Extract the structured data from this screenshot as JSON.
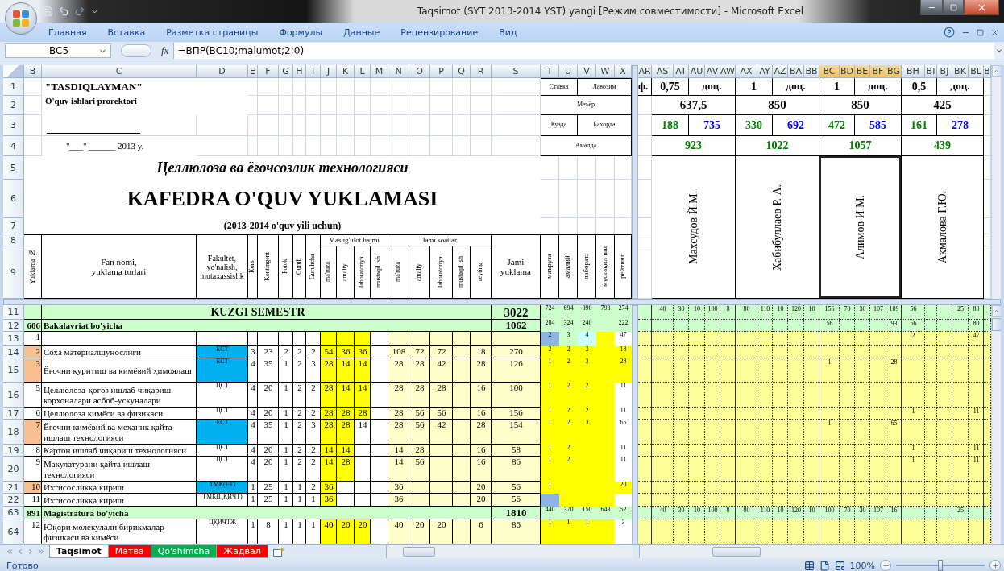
{
  "window": {
    "title": "Taqsimot (SYT 2013-2014 YST)  yangi  [Режим совместимости] - Microsoft Excel"
  },
  "ribbon_tabs": [
    "Главная",
    "Вставка",
    "Разметка страницы",
    "Формулы",
    "Данные",
    "Рецензирование",
    "Вид"
  ],
  "formula_bar": {
    "name_box": "BC5",
    "insert_function": "fx",
    "formula": "=ВПР(BC10;malumot;2;0)"
  },
  "left_columns": [
    {
      "label": "B",
      "selected": false
    },
    {
      "label": "C",
      "selected": false
    },
    {
      "label": "D",
      "selected": false
    },
    {
      "label": "E",
      "selected": false
    },
    {
      "label": "F",
      "selected": false
    },
    {
      "label": "G",
      "selected": false
    },
    {
      "label": "H",
      "selected": false
    },
    {
      "label": "I",
      "selected": false
    },
    {
      "label": "J",
      "selected": false
    },
    {
      "label": "K",
      "selected": false
    },
    {
      "label": "L",
      "selected": false
    },
    {
      "label": "M",
      "selected": false
    },
    {
      "label": "N",
      "selected": false
    },
    {
      "label": "O",
      "selected": false
    },
    {
      "label": "P",
      "selected": false
    },
    {
      "label": "Q",
      "selected": false
    },
    {
      "label": "R",
      "selected": false
    },
    {
      "label": "S",
      "selected": false
    },
    {
      "label": "T",
      "selected": false
    },
    {
      "label": "U",
      "selected": false
    },
    {
      "label": "V",
      "selected": false
    },
    {
      "label": "W",
      "selected": false
    },
    {
      "label": "X",
      "selected": false
    }
  ],
  "right_columns": [
    {
      "label": "AR",
      "selected": false
    },
    {
      "label": "AS",
      "selected": false
    },
    {
      "label": "AT",
      "selected": false
    },
    {
      "label": "AU",
      "selected": false
    },
    {
      "label": "AV",
      "selected": false
    },
    {
      "label": "AW",
      "selected": false
    },
    {
      "label": "AX",
      "selected": false
    },
    {
      "label": "AY",
      "selected": false
    },
    {
      "label": "AZ",
      "selected": false
    },
    {
      "label": "BA",
      "selected": false
    },
    {
      "label": "BB",
      "selected": false
    },
    {
      "label": "BC",
      "selected": true
    },
    {
      "label": "BD",
      "selected": true
    },
    {
      "label": "BE",
      "selected": true
    },
    {
      "label": "BF",
      "selected": true
    },
    {
      "label": "BG",
      "selected": true
    },
    {
      "label": "BH",
      "selected": false
    },
    {
      "label": "BI",
      "selected": false
    },
    {
      "label": "BJ",
      "selected": false
    },
    {
      "label": "BK",
      "selected": false
    },
    {
      "label": "BL",
      "selected": false
    },
    {
      "label": "B",
      "selected": false
    }
  ],
  "top_rows": [
    "1",
    "2",
    "3",
    "4",
    "5",
    "6",
    "7",
    "8",
    "9"
  ],
  "title_block": {
    "approval": "\"TASDIQLAYMAN\"",
    "approver": "O'quv ishlari prorektori",
    "date_line": "\"___\" ______ 2013 y.",
    "department": "Целлюлоза ва ёғочсозлик технологияси",
    "title": "KAFEDRA O'QUV YUKLAMASI",
    "year": "(2013-2014 o'quv yili uchun)"
  },
  "table_header": {
    "number": "Yuklama №",
    "subject": "Fan nomi,\nyuklama turlari",
    "faculty": "Fakultet,\nyo'nalish,\nmutaxassislik",
    "counts": [
      "Kurs",
      "Kontingent",
      "Potok",
      "Guruh",
      "Guruhcha"
    ],
    "lessons": "Mashg'ulot hajmi",
    "lesson_columns": [
      "ma'ruza",
      "amaliy",
      "laboratoriya",
      "mustaqil ish"
    ],
    "hours": "Jami soatlar",
    "hour_columns": [
      "ma'ruza",
      "amaliy",
      "laboratoriya",
      "mustaqil ish",
      "reyting"
    ],
    "total": "Jami\nyuklama"
  },
  "summary_header": {
    "rate": "Ставка",
    "position": "Лавозим",
    "norm": "Меъёр",
    "autumn": "Кузда",
    "spring": "Бахорда",
    "actual": "Амалда",
    "columns": [
      "маъруза",
      "амалий",
      "лаборат.",
      "мустақил иш",
      "рейтинг"
    ]
  },
  "cut_cell": "ф.",
  "teachers": [
    {
      "rate": "0,75",
      "position": "доц.",
      "norm": "637,5",
      "autumn": "188",
      "spring": "735",
      "actual": "923",
      "name": "Махсудов Й.М.",
      "selected": false
    },
    {
      "rate": "1",
      "position": "доц.",
      "norm": "850",
      "autumn": "330",
      "spring": "692",
      "actual": "1022",
      "name": "Хабибуллаев Р. А.",
      "selected": false
    },
    {
      "rate": "1",
      "position": "доц.",
      "norm": "850",
      "autumn": "472",
      "spring": "585",
      "actual": "1057",
      "name": "Алимов И.М.",
      "selected": true
    },
    {
      "rate": "0,5",
      "position": "доц.",
      "norm": "425",
      "autumn": "161",
      "spring": "278",
      "actual": "439",
      "name": "Акмалова Г.Ю.",
      "selected": false
    }
  ],
  "rows": [
    {
      "row": "11",
      "kind": "semester",
      "title": "KUZGI SEMESTR",
      "total": "3022",
      "summary": {
        "lecture": "724",
        "practice": "694",
        "lab": "390",
        "independent": "793",
        "rating": "274"
      },
      "teacher_1": {
        "column_1": "40",
        "column_2": "30",
        "column_3": "10",
        "column_4": "100",
        "column_5": "8"
      },
      "teacher_2": {
        "column_1": "80",
        "column_2": "110",
        "column_3": "10",
        "column_4": "120",
        "column_5": "10"
      },
      "teacher_3": {
        "column_1": "156",
        "column_2": "70",
        "column_3": "30",
        "column_4": "107",
        "column_5": "109"
      },
      "teacher_4": {
        "column_1": "56",
        "column_4": "25",
        "column_5": "80"
      }
    },
    {
      "row": "12",
      "kind": "level",
      "number": "606",
      "title": "Bakalavriat bo'yicha",
      "total": "1062",
      "summary": {
        "lecture": "284",
        "practice": "324",
        "lab": "240",
        "rating": "222"
      },
      "teacher_3": {
        "column_1": "56",
        "column_5": "93"
      },
      "teacher_4": {
        "column_1": "56",
        "column_5": "80"
      }
    },
    {
      "row": "13",
      "kind": "item",
      "number": {
        "text": "1"
      },
      "hours": [
        {
          "highlighted": true
        },
        {
          "highlighted": true
        },
        {
          "highlighted": true
        },
        {
          "highlighted": false
        }
      ],
      "rating": [
        {
          "text": "2",
          "color": "#8db4e2"
        },
        {
          "text": "3",
          "color": "#ccffcc"
        },
        {
          "text": "4",
          "color": "#ccffff"
        },
        {
          "color": "#ffff00"
        },
        {
          "text": "47",
          "color": "#ffffff"
        }
      ],
      "teacher_4": {
        "column_1": "2",
        "column_5": "47"
      }
    },
    {
      "row": "14",
      "kind": "item",
      "number": {
        "text": "2",
        "color": "#fabf8f"
      },
      "name": "Соха материалшунослиги",
      "faculty": {
        "text": "ЕСТ",
        "color": "#00b0f0"
      },
      "counts": [
        "3",
        "23",
        "2",
        "2",
        "2"
      ],
      "hours": [
        {
          "text": "54",
          "highlighted": true
        },
        {
          "text": "36",
          "highlighted": true
        },
        {
          "text": "36",
          "highlighted": true
        },
        {
          "highlighted": false
        }
      ],
      "totals": {
        "lecture": "108",
        "practice": "72",
        "lab": "72",
        "rating": "18"
      },
      "total": "270",
      "rating": [
        {
          "text": "2",
          "color": "#ffff00"
        },
        {
          "text": "2",
          "color": "#ffff00"
        },
        {
          "text": "2",
          "color": "#ffff00"
        },
        {
          "color": "#ffff00"
        },
        {
          "text": "18",
          "color": "#ffff00"
        }
      ]
    },
    {
      "row": "15",
      "kind": "item",
      "number": {
        "text": "3",
        "color": "#fabf8f"
      },
      "name": "Ёғочни қуритиш ва кимёвий ҳимоялаш",
      "faculty": {
        "text": "ЕСТ",
        "color": "#00b0f0"
      },
      "counts": [
        "4",
        "35",
        "1",
        "2",
        "3"
      ],
      "hours": [
        {
          "text": "28",
          "highlighted": true
        },
        {
          "text": "14",
          "highlighted": true
        },
        {
          "text": "14",
          "highlighted": true
        },
        {
          "highlighted": false
        }
      ],
      "totals": {
        "lecture": "28",
        "practice": "28",
        "lab": "42",
        "rating": "28"
      },
      "total": "126",
      "rating": [
        {
          "text": "1",
          "color": "#ffff00"
        },
        {
          "text": "2",
          "color": "#ffff00"
        },
        {
          "text": "3",
          "color": "#ffff00"
        },
        {
          "color": "#ffff00"
        },
        {
          "text": "28",
          "color": "#ffff00"
        }
      ],
      "teacher_3": {
        "column_1": "1",
        "column_5": "28"
      }
    },
    {
      "row": "16",
      "kind": "item",
      "number": {
        "text": "5"
      },
      "name": "Целлюлоза-қоғоз ишлаб чиқариш корхоналари асбоб-ускуналари",
      "faculty": {
        "text": "ЦСТ"
      },
      "counts": [
        "4",
        "20",
        "1",
        "2",
        "2"
      ],
      "hours": [
        {
          "text": "28",
          "highlighted": true
        },
        {
          "text": "14",
          "highlighted": true
        },
        {
          "text": "14",
          "highlighted": true
        },
        {
          "highlighted": false
        }
      ],
      "totals": {
        "lecture": "28",
        "practice": "28",
        "lab": "28",
        "rating": "16"
      },
      "total": "100",
      "rating": [
        {
          "text": "1",
          "color": "#ffff00"
        },
        {
          "text": "2",
          "color": "#ffff00"
        },
        {
          "text": "2",
          "color": "#ffff00"
        },
        {
          "color": "#ffff00"
        },
        {
          "text": "11",
          "color": "#ffffff"
        }
      ]
    },
    {
      "row": "17",
      "kind": "item",
      "number": {
        "text": "6"
      },
      "name": "Целлюлоза кимёси ва физикаси",
      "faculty": {
        "text": "ЦСТ"
      },
      "counts": [
        "4",
        "20",
        "1",
        "2",
        "2"
      ],
      "hours": [
        {
          "text": "28",
          "highlighted": true
        },
        {
          "text": "28",
          "highlighted": true
        },
        {
          "text": "28",
          "highlighted": true
        },
        {
          "highlighted": false
        }
      ],
      "totals": {
        "lecture": "28",
        "practice": "56",
        "lab": "56",
        "rating": "16"
      },
      "total": "156",
      "rating": [
        {
          "text": "1",
          "color": "#ffff00"
        },
        {
          "text": "2",
          "color": "#ffff00"
        },
        {
          "text": "2",
          "color": "#ffff00"
        },
        {
          "color": "#ffff00"
        },
        {
          "text": "11",
          "color": "#ffffff"
        }
      ],
      "teacher_4": {
        "column_1": "1",
        "column_5": "11"
      }
    },
    {
      "row": "18",
      "kind": "item",
      "number": {
        "text": "7",
        "color": "#fabf8f"
      },
      "name": "Ёғочни кимёвий ва механик қайта ишлаш технологияси",
      "faculty": {
        "text": "ЕСТ",
        "color": "#00b0f0"
      },
      "counts": [
        "4",
        "35",
        "1",
        "2",
        "3"
      ],
      "hours": [
        {
          "text": "28",
          "highlighted": true
        },
        {
          "text": "28",
          "highlighted": true
        },
        {
          "text": "14",
          "highlighted": false
        },
        {
          "highlighted": false
        }
      ],
      "totals": {
        "lecture": "28",
        "practice": "56",
        "lab": "42",
        "rating": "28"
      },
      "total": "154",
      "rating": [
        {
          "text": "1",
          "color": "#ffff00"
        },
        {
          "text": "2",
          "color": "#ffff00"
        },
        {
          "text": "3",
          "color": "#ffff00"
        },
        {
          "color": "#ffff00"
        },
        {
          "text": "65",
          "color": "#ffffff"
        }
      ],
      "teacher_3": {
        "column_1": "1",
        "column_5": "65"
      }
    },
    {
      "row": "19",
      "kind": "item",
      "number": {
        "text": "8"
      },
      "name": "Картон ишлаб чиқариш технологияси",
      "faculty": {
        "text": "ЦСТ"
      },
      "counts": [
        "4",
        "20",
        "1",
        "2",
        "2"
      ],
      "hours": [
        {
          "text": "14",
          "highlighted": true
        },
        {
          "text": "14",
          "highlighted": true
        },
        {
          "highlighted": false
        },
        {
          "highlighted": false
        }
      ],
      "totals": {
        "lecture": "14",
        "practice": "28",
        "rating": "16"
      },
      "total": "58",
      "rating": [
        {
          "text": "1",
          "color": "#ffff00"
        },
        {
          "text": "2",
          "color": "#ffff00"
        },
        {
          "color": "#ffff00"
        },
        {
          "color": "#ffff00"
        },
        {
          "text": "11",
          "color": "#ffffff"
        }
      ],
      "teacher_4": {
        "column_1": "1",
        "column_5": "11"
      }
    },
    {
      "row": "20",
      "kind": "item",
      "number": {
        "text": "9"
      },
      "name": "Макулатурани қайта ишлаш технологияси",
      "faculty": {
        "text": "ЦСТ"
      },
      "counts": [
        "4",
        "20",
        "1",
        "2",
        "2"
      ],
      "hours": [
        {
          "text": "14",
          "highlighted": true
        },
        {
          "text": "28",
          "highlighted": true
        },
        {
          "highlighted": false
        },
        {
          "highlighted": false
        }
      ],
      "totals": {
        "lecture": "14",
        "practice": "56",
        "rating": "16"
      },
      "total": "86",
      "rating": [
        {
          "text": "1",
          "color": "#ffff00"
        },
        {
          "text": "2",
          "color": "#ffff00"
        },
        {
          "color": "#ffff00"
        },
        {
          "color": "#ffff00"
        },
        {
          "text": "11",
          "color": "#ffffff"
        }
      ],
      "teacher_4": {
        "column_1": "1",
        "column_5": "11"
      }
    },
    {
      "row": "21",
      "kind": "item",
      "number": {
        "text": "10",
        "color": "#fabf8f"
      },
      "name": "Ихтисосликка кириш",
      "faculty": {
        "text": "ТМК(ЕТ)",
        "color": "#00b0f0"
      },
      "counts": [
        "1",
        "25",
        "1",
        "1",
        "2"
      ],
      "hours": [
        {
          "text": "36",
          "highlighted": true
        },
        {
          "highlighted": false
        },
        {
          "highlighted": false
        },
        {
          "highlighted": false
        }
      ],
      "totals": {
        "lecture": "36",
        "rating": "20"
      },
      "total": "56",
      "rating": [
        {
          "text": "1",
          "color": "#ffff00"
        },
        {
          "color": "#ffff00"
        },
        {
          "color": "#ffff00"
        },
        {
          "color": "#ffff00"
        },
        {
          "text": "20",
          "color": "#ffff00"
        }
      ]
    },
    {
      "row": "22",
      "kind": "item",
      "number": {
        "text": "11"
      },
      "name": "Ихтисосликка кириш",
      "faculty": {
        "text": "ТМК(ЦҚИЧТ)"
      },
      "counts": [
        "1",
        "25",
        "1",
        "1",
        "1"
      ],
      "hours": [
        {
          "text": "36",
          "highlighted": true
        },
        {
          "highlighted": false
        },
        {
          "highlighted": false
        },
        {
          "highlighted": false
        }
      ],
      "totals": {
        "lecture": "36",
        "rating": "20"
      },
      "total": "56",
      "rating": [
        {
          "color": "#8db4e2"
        },
        {
          "color": "#ffff00"
        },
        {
          "color": "#ffff00"
        },
        {
          "color": "#ffff00"
        },
        {
          "color": "#ffffff"
        }
      ]
    },
    {
      "row": "63",
      "kind": "level",
      "number": "891",
      "title": "Magistratura bo'yicha",
      "total": "1810",
      "summary": {
        "lecture": "440",
        "practice": "370",
        "lab": "150",
        "independent": "643",
        "rating": "52"
      },
      "teacher_1": {
        "column_1": "40",
        "column_2": "30",
        "column_3": "10",
        "column_4": "100",
        "column_5": "8"
      },
      "teacher_2": {
        "column_1": "80",
        "column_2": "110",
        "column_3": "10",
        "column_4": "120",
        "column_5": "10"
      },
      "teacher_3": {
        "column_1": "100",
        "column_2": "70",
        "column_3": "30",
        "column_4": "107",
        "column_5": "16"
      },
      "teacher_4": {
        "column_4": "25"
      }
    },
    {
      "row": "64",
      "kind": "item",
      "number": {
        "text": "12"
      },
      "name": "Юқори молекулали бирикмалар физикаси ва кимёси",
      "faculty": {
        "text": "ЦҚИЧТЖ"
      },
      "counts": [
        "1",
        "8",
        "1",
        "1",
        "1"
      ],
      "hours": [
        {
          "text": "40",
          "highlighted": true
        },
        {
          "text": "20",
          "highlighted": true
        },
        {
          "text": "20",
          "highlighted": true
        },
        {
          "highlighted": false
        }
      ],
      "totals": {
        "lecture": "40",
        "practice": "20",
        "lab": "20",
        "rating": "6"
      },
      "total": "86",
      "rating": [
        {
          "text": "1",
          "color": "#ffff00"
        },
        {
          "text": "1",
          "color": "#ffff00"
        },
        {
          "text": "1",
          "color": "#ffff00"
        },
        {
          "color": "#ffff00"
        },
        {
          "text": "3",
          "color": "#ffffff"
        }
      ]
    }
  ],
  "sheet_tabs": [
    {
      "label": "Taqsimot",
      "selected": true
    },
    {
      "label": "Матва",
      "selected": false,
      "color": "#ff0000"
    },
    {
      "label": "Qo'shimcha",
      "selected": false,
      "color": "#00b050"
    },
    {
      "label": "Жадвал",
      "selected": false,
      "color": "#ff0000"
    }
  ],
  "status_bar": {
    "text": "Готово",
    "zoom": {
      "reading": "100%",
      "level": 0.5
    }
  }
}
